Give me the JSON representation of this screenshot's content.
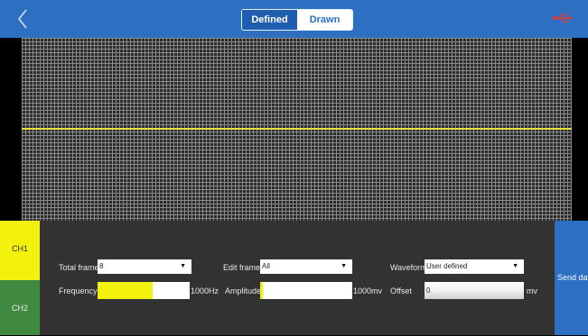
{
  "header": {
    "tabs": [
      {
        "label": "Defined",
        "active": false
      },
      {
        "label": "Drawn",
        "active": true
      }
    ]
  },
  "channels": [
    {
      "label": "CH1",
      "color": "#f2f20e",
      "selected": true
    },
    {
      "label": "CH2",
      "color": "#3f8a3f",
      "selected": false
    }
  ],
  "controls": {
    "total_frame": {
      "label": "Total frame",
      "value": "8"
    },
    "edit_frame": {
      "label": "Edit frame",
      "value": "All"
    },
    "waveform": {
      "label": "Waveform",
      "value": "User defined"
    },
    "frequency": {
      "label": "Frequency",
      "unit": "1000Hz",
      "level": 0.6
    },
    "amplitude": {
      "label": "Amplitude",
      "unit": "1000mv",
      "level": 0.03
    },
    "offset": {
      "label": "Offset",
      "value": "0",
      "unit": "mv"
    },
    "send_label": "Send data"
  },
  "colors": {
    "accent": "#2d6fc1",
    "trace": "#e6e23a",
    "usb_icon": "#e83a2a"
  }
}
